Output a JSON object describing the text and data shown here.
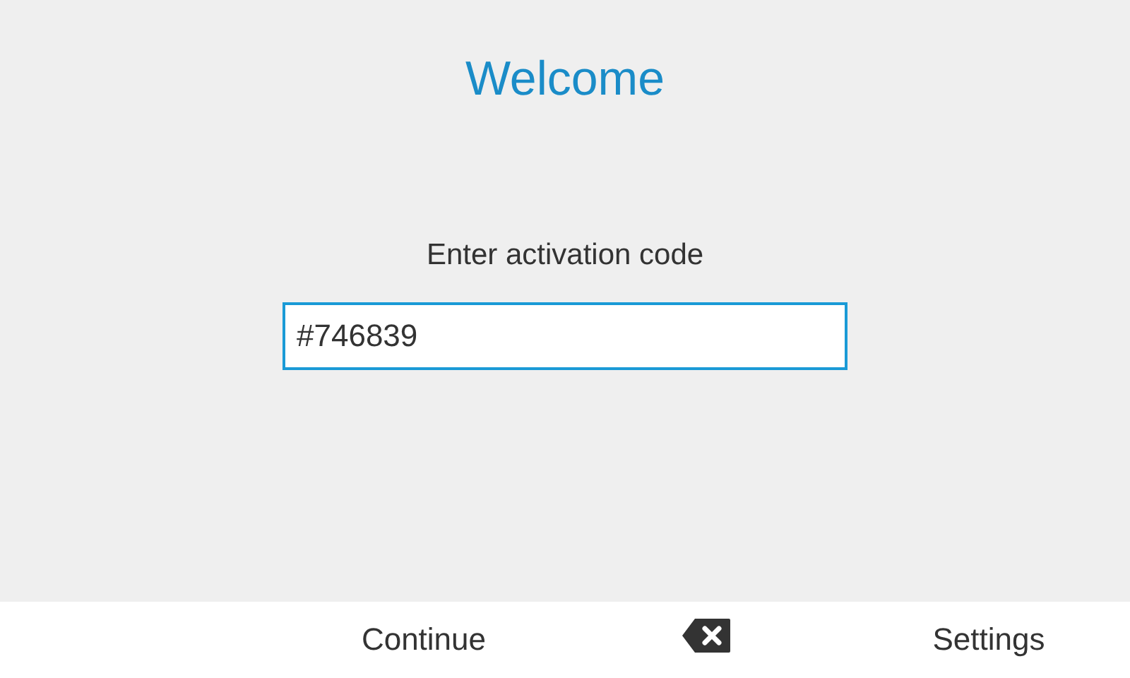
{
  "title": "Welcome",
  "activation": {
    "label": "Enter activation code",
    "value": "#746839",
    "focused": true
  },
  "softkeys": [
    {
      "kind": "text",
      "label": "Continue"
    },
    {
      "kind": "backspace"
    },
    {
      "kind": "text",
      "label": "Settings"
    }
  ]
}
